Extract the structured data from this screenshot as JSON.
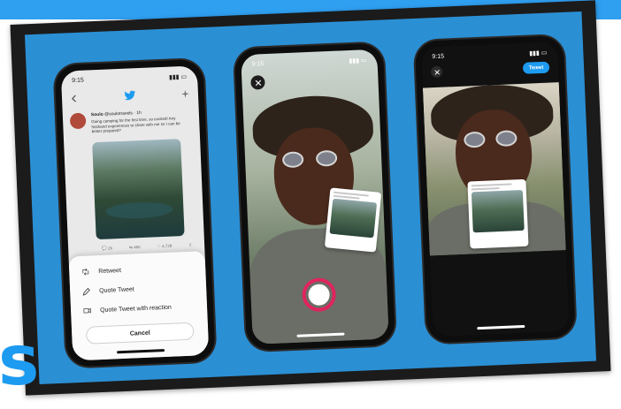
{
  "colors": {
    "twitter_blue": "#1d9bf0",
    "record_pink": "#e0245e",
    "backdrop_blue": "#2b8fd4"
  },
  "phone_1": {
    "status_time": "9:15",
    "icons": [
      "back-icon",
      "twitter-bird-icon",
      "sparkle-icon"
    ],
    "tweet": {
      "author_name": "Soulo",
      "author_handle": "@soulotravels · 1h",
      "text": "Going camping for the first time, so excited! Any firsthand experiences to share with me so I can be better prepared?"
    },
    "actions": {
      "reply_count": "26",
      "retweet_count": "466",
      "like_count": "4,728"
    },
    "sheet": {
      "retweet": "Retweet",
      "quote_tweet": "Quote Tweet",
      "quote_tweet_reaction": "Quote Tweet with reaction",
      "cancel": "Cancel"
    }
  },
  "phone_2": {
    "status_time": "9:15"
  },
  "phone_3": {
    "status_time": "9:15",
    "tweet_button": "Tweet"
  },
  "corner_glyph": "s"
}
